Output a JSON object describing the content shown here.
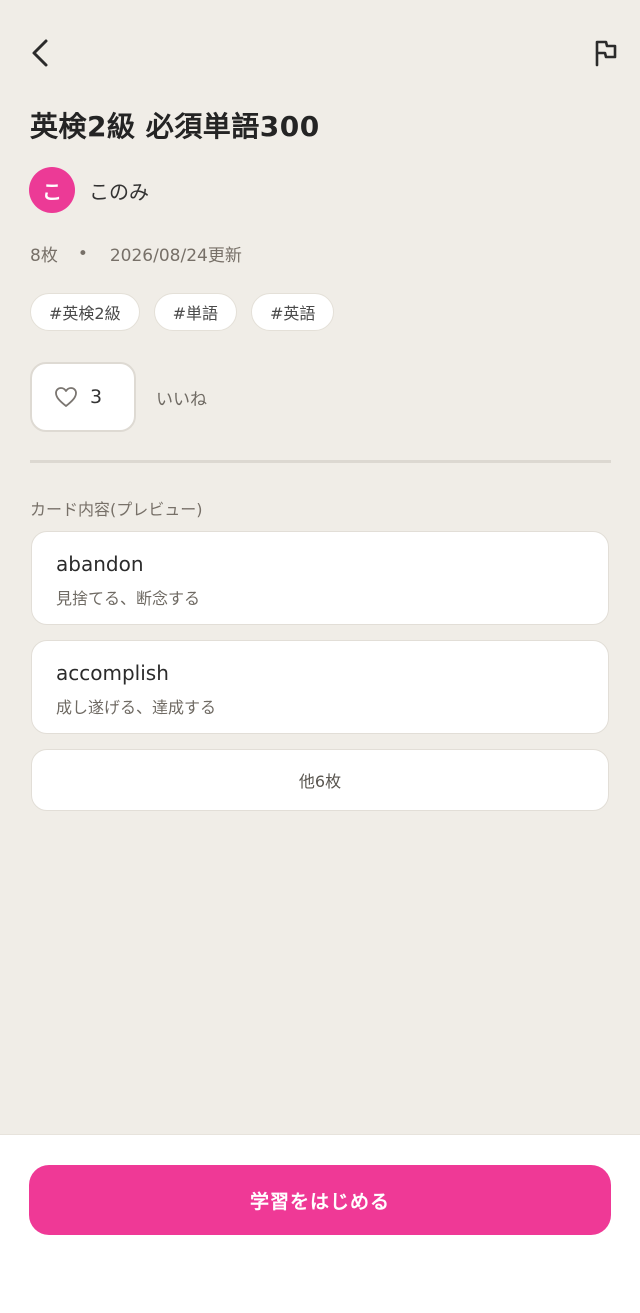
{
  "deck": {
    "title": "英検2級 必須単語300",
    "author_initial": "こ",
    "author_name": "このみ",
    "card_count": "8枚",
    "separator": "•",
    "updated": "2026/08/24更新",
    "tags": [
      "#英検2級",
      "#単語",
      "#英語"
    ],
    "likes": "3",
    "likes_label": "いいね"
  },
  "preview": {
    "section_label": "カード内容(プレビュー)",
    "cards": [
      {
        "front": "abandon",
        "back": "見捨てる、断念する"
      },
      {
        "front": "accomplish",
        "back": "成し遂げる、達成する"
      }
    ],
    "more_label": "他6枚"
  },
  "actions": {
    "start_label": "学習をはじめる"
  },
  "icons": {
    "back": "chevron-left-icon",
    "report": "flag-icon",
    "like": "heart-outline-icon"
  },
  "colors": {
    "accent": "#ef3996",
    "background": "#f0ede7"
  }
}
